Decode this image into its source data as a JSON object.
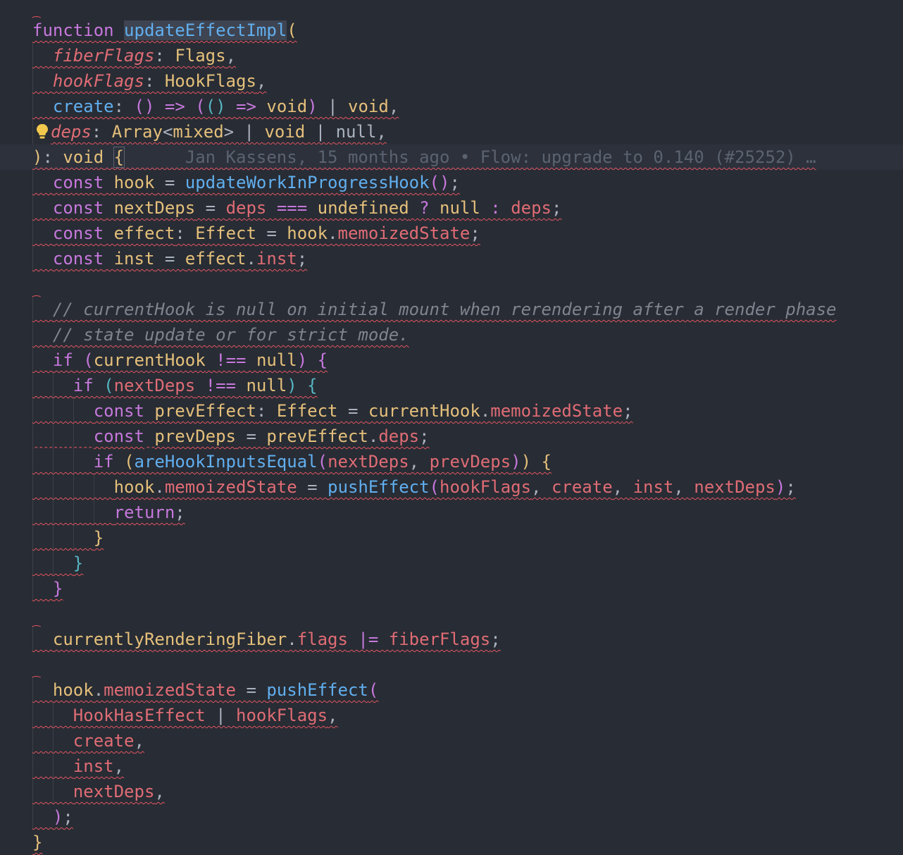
{
  "editor": {
    "blame_annotation": "Jan Kassens, 15 months ago • Flow: upgrade to 0.140 (#25252) …",
    "lines": [
      [
        [
          "kw",
          "function"
        ],
        [
          "pu",
          " "
        ],
        [
          "fn sel",
          "updateEffectImpl"
        ],
        [
          "b1",
          "("
        ]
      ],
      [
        [
          "pu",
          "  "
        ],
        [
          "pa",
          "fiberFlags"
        ],
        [
          "pu",
          ": "
        ],
        [
          "ty",
          "Flags"
        ],
        [
          "pu",
          ","
        ]
      ],
      [
        [
          "pu",
          "  "
        ],
        [
          "pa",
          "hookFlags"
        ],
        [
          "pu",
          ": "
        ],
        [
          "ty",
          "HookFlags"
        ],
        [
          "pu",
          ","
        ]
      ],
      [
        [
          "pu",
          "  "
        ],
        [
          "fn",
          "create"
        ],
        [
          "pu",
          ": "
        ],
        [
          "b2",
          "()"
        ],
        [
          "pu",
          " "
        ],
        [
          "kw",
          "=>"
        ],
        [
          "pu",
          " "
        ],
        [
          "b2",
          "("
        ],
        [
          "b3",
          "()"
        ],
        [
          "pu",
          " "
        ],
        [
          "kw",
          "=>"
        ],
        [
          "pu",
          " "
        ],
        [
          "ty",
          "void"
        ],
        [
          "b2",
          ")"
        ],
        [
          "pu",
          " | "
        ],
        [
          "ty",
          "void"
        ],
        [
          "pu",
          ","
        ]
      ],
      [
        [
          "pu",
          "  "
        ],
        [
          "pa",
          "deps"
        ],
        [
          "pu",
          ": "
        ],
        [
          "ty",
          "Array"
        ],
        [
          "pu",
          "<"
        ],
        [
          "ty",
          "mixed"
        ],
        [
          "pu",
          "> | "
        ],
        [
          "ty",
          "void"
        ],
        [
          "pu",
          " | "
        ],
        [
          "pu",
          "null"
        ],
        [
          "pu",
          ","
        ]
      ],
      [
        [
          "b1",
          ")"
        ],
        [
          "pu",
          ": "
        ],
        [
          "ty",
          "void"
        ],
        [
          "pu",
          " "
        ],
        [
          "b1 bm",
          "{"
        ]
      ],
      [
        [
          "pu",
          "  "
        ],
        [
          "kw",
          "const"
        ],
        [
          "pu",
          " "
        ],
        [
          "id",
          "hook"
        ],
        [
          "pu",
          " = "
        ],
        [
          "fn",
          "updateWorkInProgressHook"
        ],
        [
          "b2",
          "()"
        ],
        [
          "pu",
          ";"
        ]
      ],
      [
        [
          "pu",
          "  "
        ],
        [
          "kw",
          "const"
        ],
        [
          "pu",
          " "
        ],
        [
          "id",
          "nextDeps"
        ],
        [
          "pu",
          " = "
        ],
        [
          "vr",
          "deps"
        ],
        [
          "pu",
          " "
        ],
        [
          "kw",
          "==="
        ],
        [
          "pu",
          " "
        ],
        [
          "ty",
          "undefined"
        ],
        [
          "pu",
          " "
        ],
        [
          "kw",
          "?"
        ],
        [
          "pu",
          " "
        ],
        [
          "ty",
          "null"
        ],
        [
          "pu",
          " "
        ],
        [
          "kw",
          ":"
        ],
        [
          "pu",
          " "
        ],
        [
          "vr",
          "deps"
        ],
        [
          "pu",
          ";"
        ]
      ],
      [
        [
          "pu",
          "  "
        ],
        [
          "kw",
          "const"
        ],
        [
          "pu",
          " "
        ],
        [
          "id",
          "effect"
        ],
        [
          "pu",
          ": "
        ],
        [
          "ty",
          "Effect"
        ],
        [
          "pu",
          " = "
        ],
        [
          "id",
          "hook"
        ],
        [
          "pu",
          "."
        ],
        [
          "pr",
          "memoizedState"
        ],
        [
          "pu",
          ";"
        ]
      ],
      [
        [
          "pu",
          "  "
        ],
        [
          "kw",
          "const"
        ],
        [
          "pu",
          " "
        ],
        [
          "id",
          "inst"
        ],
        [
          "pu",
          " = "
        ],
        [
          "id",
          "effect"
        ],
        [
          "pu",
          "."
        ],
        [
          "pr",
          "inst"
        ],
        [
          "pu",
          ";"
        ]
      ],
      [],
      [
        [
          "pu",
          "  "
        ],
        [
          "cm",
          "// currentHook is null on initial mount when rerendering after a render phase"
        ]
      ],
      [
        [
          "pu",
          "  "
        ],
        [
          "cm",
          "// state update or for strict mode."
        ]
      ],
      [
        [
          "pu",
          "  "
        ],
        [
          "kw",
          "if"
        ],
        [
          "pu",
          " "
        ],
        [
          "b2",
          "("
        ],
        [
          "id",
          "currentHook"
        ],
        [
          "pu",
          " "
        ],
        [
          "kw",
          "!=="
        ],
        [
          "pu",
          " "
        ],
        [
          "ty",
          "null"
        ],
        [
          "b2",
          ")"
        ],
        [
          "pu",
          " "
        ],
        [
          "b2",
          "{"
        ]
      ],
      [
        [
          "pu",
          "    "
        ],
        [
          "kw",
          "if"
        ],
        [
          "pu",
          " "
        ],
        [
          "b3",
          "("
        ],
        [
          "vr",
          "nextDeps"
        ],
        [
          "pu",
          " "
        ],
        [
          "kw",
          "!=="
        ],
        [
          "pu",
          " "
        ],
        [
          "ty",
          "null"
        ],
        [
          "b3",
          ")"
        ],
        [
          "pu",
          " "
        ],
        [
          "b3",
          "{"
        ]
      ],
      [
        [
          "pu",
          "      "
        ],
        [
          "kw",
          "const"
        ],
        [
          "pu",
          " "
        ],
        [
          "id",
          "prevEffect"
        ],
        [
          "pu",
          ": "
        ],
        [
          "ty",
          "Effect"
        ],
        [
          "pu",
          " = "
        ],
        [
          "id",
          "currentHook"
        ],
        [
          "pu",
          "."
        ],
        [
          "pr",
          "memoizedState"
        ],
        [
          "pu",
          ";"
        ]
      ],
      [
        [
          "pu",
          "      "
        ],
        [
          "kw",
          "const"
        ],
        [
          "pu",
          " "
        ],
        [
          "id",
          "prevDeps"
        ],
        [
          "pu",
          " = "
        ],
        [
          "id",
          "prevEffect"
        ],
        [
          "pu",
          "."
        ],
        [
          "pr",
          "deps"
        ],
        [
          "pu",
          ";"
        ]
      ],
      [
        [
          "pu",
          "      "
        ],
        [
          "kw",
          "if"
        ],
        [
          "pu",
          " "
        ],
        [
          "b1",
          "("
        ],
        [
          "fn",
          "areHookInputsEqual"
        ],
        [
          "b2",
          "("
        ],
        [
          "vr",
          "nextDeps"
        ],
        [
          "pu",
          ", "
        ],
        [
          "vr",
          "prevDeps"
        ],
        [
          "b2",
          ")"
        ],
        [
          "b1",
          ")"
        ],
        [
          "pu",
          " "
        ],
        [
          "b1",
          "{"
        ]
      ],
      [
        [
          "pu",
          "        "
        ],
        [
          "id",
          "hook"
        ],
        [
          "pu",
          "."
        ],
        [
          "pr",
          "memoizedState"
        ],
        [
          "pu",
          " = "
        ],
        [
          "fn",
          "pushEffect"
        ],
        [
          "b2",
          "("
        ],
        [
          "vr",
          "hookFlags"
        ],
        [
          "pu",
          ", "
        ],
        [
          "vr",
          "create"
        ],
        [
          "pu",
          ", "
        ],
        [
          "vr",
          "inst"
        ],
        [
          "pu",
          ", "
        ],
        [
          "vr",
          "nextDeps"
        ],
        [
          "b2",
          ")"
        ],
        [
          "pu",
          ";"
        ]
      ],
      [
        [
          "pu",
          "        "
        ],
        [
          "kw",
          "return"
        ],
        [
          "pu",
          ";"
        ]
      ],
      [
        [
          "pu",
          "      "
        ],
        [
          "b1",
          "}"
        ]
      ],
      [
        [
          "pu",
          "    "
        ],
        [
          "b3",
          "}"
        ]
      ],
      [
        [
          "pu",
          "  "
        ],
        [
          "b2",
          "}"
        ]
      ],
      [],
      [
        [
          "pu",
          "  "
        ],
        [
          "id",
          "currentlyRenderingFiber"
        ],
        [
          "pu",
          "."
        ],
        [
          "pr",
          "flags"
        ],
        [
          "pu",
          " "
        ],
        [
          "kw",
          "|="
        ],
        [
          "pu",
          " "
        ],
        [
          "vr",
          "fiberFlags"
        ],
        [
          "pu",
          ";"
        ]
      ],
      [],
      [
        [
          "pu",
          "  "
        ],
        [
          "id",
          "hook"
        ],
        [
          "pu",
          "."
        ],
        [
          "pr",
          "memoizedState"
        ],
        [
          "pu",
          " = "
        ],
        [
          "fn",
          "pushEffect"
        ],
        [
          "b2",
          "("
        ]
      ],
      [
        [
          "pu",
          "    "
        ],
        [
          "vr",
          "HookHasEffect"
        ],
        [
          "pu",
          " | "
        ],
        [
          "vr",
          "hookFlags"
        ],
        [
          "pu",
          ","
        ]
      ],
      [
        [
          "pu",
          "    "
        ],
        [
          "vr",
          "create"
        ],
        [
          "pu",
          ","
        ]
      ],
      [
        [
          "pu",
          "    "
        ],
        [
          "vr",
          "inst"
        ],
        [
          "pu",
          ","
        ]
      ],
      [
        [
          "pu",
          "    "
        ],
        [
          "vr",
          "nextDeps"
        ],
        [
          "pu",
          ","
        ]
      ],
      [
        [
          "pu",
          "  "
        ],
        [
          "b2",
          ")"
        ],
        [
          "pu",
          ";"
        ]
      ],
      [
        [
          "b1",
          "}"
        ]
      ]
    ],
    "current_line_index": 5,
    "bulb_line_index": 4,
    "caret_mark_lines": [
      0,
      11,
      24,
      26
    ]
  }
}
